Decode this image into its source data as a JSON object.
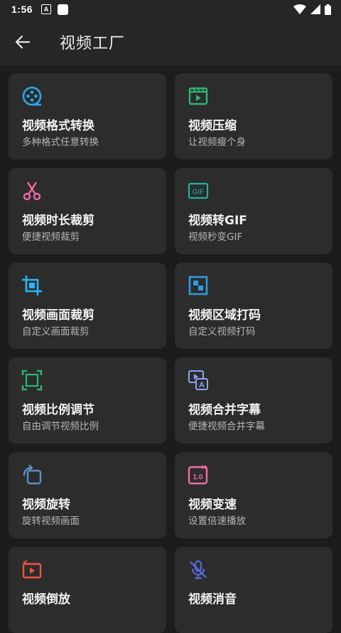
{
  "status_bar": {
    "time": "1:56",
    "notif_icon_letter": "A"
  },
  "app_bar": {
    "title": "视频工厂",
    "back_icon": "arrow-left-icon"
  },
  "colors": {
    "background": "#1c1c1c",
    "card": "#2c2c2c",
    "bar": "#262626"
  },
  "tools": [
    {
      "title": "视频格式转换",
      "subtitle": "多种格式任意转换",
      "icon": "film-reel-icon",
      "color": "#29a8f5"
    },
    {
      "title": "视频压缩",
      "subtitle": "让视频瘦个身",
      "icon": "video-play-icon",
      "color": "#2bb673"
    },
    {
      "title": "视频时长裁剪",
      "subtitle": "便捷视频裁剪",
      "icon": "scissors-icon",
      "color": "#f06aa8"
    },
    {
      "title": "视频转GIF",
      "subtitle": "视频秒变GIF",
      "icon": "gif-icon",
      "color": "#1fb39a",
      "icon_text": "GIF"
    },
    {
      "title": "视频画面裁剪",
      "subtitle": "自定义画面裁剪",
      "icon": "crop-icon",
      "color": "#29b6f6"
    },
    {
      "title": "视频区域打码",
      "subtitle": "自定义视频打码",
      "icon": "mosaic-icon",
      "color": "#2f9bdf"
    },
    {
      "title": "视频比例调节",
      "subtitle": "自由调节视频比例",
      "icon": "aspect-ratio-icon",
      "color": "#2bb673"
    },
    {
      "title": "视频合并字幕",
      "subtitle": "便捷视频合并字幕",
      "icon": "subtitle-icon",
      "color": "#8aa4f0",
      "icon_text": "A"
    },
    {
      "title": "视频旋转",
      "subtitle": "旋转视频画面",
      "icon": "rotate-icon",
      "color": "#5a8fc8"
    },
    {
      "title": "视频变速",
      "subtitle": "设置倍速播放",
      "icon": "speed-icon",
      "color": "#f06aa8",
      "icon_text": "1.0"
    },
    {
      "title": "视频倒放",
      "subtitle": "",
      "icon": "reverse-play-icon",
      "color": "#f0533e"
    },
    {
      "title": "视频消音",
      "subtitle": "",
      "icon": "mute-mic-icon",
      "color": "#5968d8"
    }
  ]
}
